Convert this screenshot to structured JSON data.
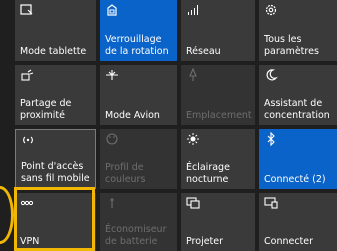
{
  "tiles": [
    {
      "id": "tablet-mode",
      "label": "Mode tablette",
      "icon": "tablet-mode-icon",
      "state": "off"
    },
    {
      "id": "rotation-lock",
      "label": "Verrouillage de la rotation",
      "icon": "rotation-lock-icon",
      "state": "on"
    },
    {
      "id": "network",
      "label": "Réseau",
      "icon": "network-icon",
      "state": "off"
    },
    {
      "id": "all-settings",
      "label": "Tous les paramètres",
      "icon": "gear-icon",
      "state": "off"
    },
    {
      "id": "nearby-sharing",
      "label": "Partage de proximité",
      "icon": "nearby-share-icon",
      "state": "off"
    },
    {
      "id": "airplane-mode",
      "label": "Mode Avion",
      "icon": "airplane-icon",
      "state": "off"
    },
    {
      "id": "location",
      "label": "Emplacement",
      "icon": "location-icon",
      "state": "disabled"
    },
    {
      "id": "focus-assist",
      "label": "Assistant de concentration",
      "icon": "moon-icon",
      "state": "off"
    },
    {
      "id": "mobile-hotspot",
      "label": "Point d'accès sans fil mobile",
      "icon": "hotspot-icon",
      "state": "off"
    },
    {
      "id": "color-profile",
      "label": "Profil de couleurs",
      "icon": "palette-icon",
      "state": "disabled"
    },
    {
      "id": "night-light",
      "label": "Éclairage nocturne",
      "icon": "sun-icon",
      "state": "off"
    },
    {
      "id": "bluetooth",
      "label": "Connecté (2)",
      "icon": "bluetooth-icon",
      "state": "on"
    },
    {
      "id": "vpn",
      "label": "VPN",
      "icon": "vpn-icon",
      "state": "off"
    },
    {
      "id": "battery-saver",
      "label": "Économiseur de batterie",
      "icon": "battery-saver-icon",
      "state": "disabled"
    },
    {
      "id": "project",
      "label": "Projeter",
      "icon": "project-icon",
      "state": "off"
    },
    {
      "id": "connect",
      "label": "Connecter",
      "icon": "connect-icon",
      "state": "off"
    }
  ],
  "colors": {
    "accent": "#0a63c9",
    "tile": "#3a3a3a",
    "highlight": "#f2b705"
  }
}
